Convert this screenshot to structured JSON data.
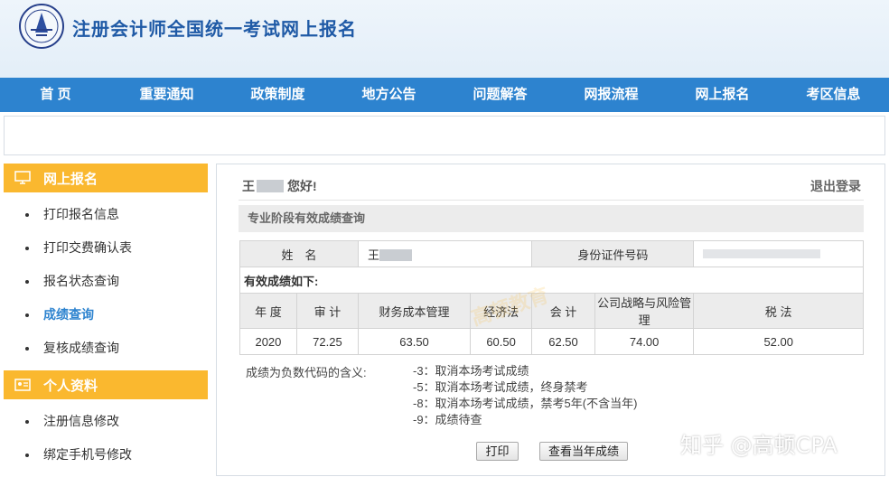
{
  "header": {
    "title": "注册会计师全国统一考试网上报名"
  },
  "nav": {
    "items": [
      "首 页",
      "重要通知",
      "政策制度",
      "地方公告",
      "问题解答",
      "网报流程",
      "网上报名",
      "考区信息"
    ]
  },
  "sidebar": {
    "section1": {
      "title": "网上报名",
      "items": [
        "打印报名信息",
        "打印交费确认表",
        "报名状态查询",
        "成绩查询",
        "复核成绩查询"
      ]
    },
    "section2": {
      "title": "个人资料",
      "items": [
        "注册信息修改",
        "绑定手机号修改"
      ]
    },
    "active_item": "成绩查询"
  },
  "main": {
    "greeting_name": "王",
    "greeting_suffix": "您好!",
    "logout": "退出登录",
    "section_title": "专业阶段有效成绩查询",
    "name_label": "姓　名",
    "name_value": "王",
    "id_label": "身份证件号码",
    "effective_label": "有效成绩如下:",
    "grade_headers": [
      "年 度",
      "审 计",
      "财务成本管理",
      "经济法",
      "会 计",
      "公司战略与风险管理",
      "税 法"
    ],
    "grade_values": [
      "2020",
      "72.25",
      "63.50",
      "60.50",
      "62.50",
      "74.00",
      "52.00"
    ],
    "notes_title": "成绩为负数代码的含义:",
    "codes": [
      "-3：取消本场考试成绩",
      "-5：取消本场考试成绩，终身禁考",
      "-8：取消本场考试成绩，禁考5年(不含当年)",
      "-9：成绩待查"
    ],
    "print_button": "打印",
    "view_year_button": "查看当年成绩"
  },
  "watermarks": {
    "corner": "知乎 @高顿CPA",
    "center": "高顿教育"
  },
  "colors": {
    "nav": "#2d83cf",
    "sidebar_head": "#fab82f",
    "title": "#1f5aa6"
  }
}
